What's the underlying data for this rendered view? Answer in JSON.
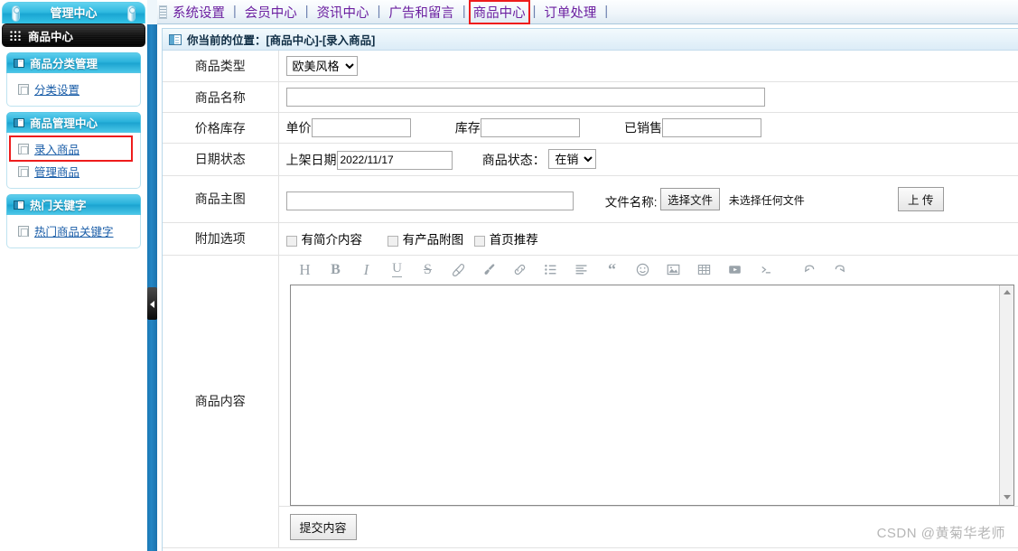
{
  "sidebar": {
    "header_title": "管理中心",
    "current_module": "商品中心",
    "current_module_icon": "grid-dots-icon",
    "groups": [
      {
        "title": "商品分类管理",
        "icon": "window-icon",
        "items": [
          {
            "label": "分类设置",
            "icon": "page-icon",
            "highlighted": false
          }
        ]
      },
      {
        "title": "商品管理中心",
        "icon": "window-icon",
        "items": [
          {
            "label": "录入商品",
            "icon": "page-icon",
            "highlighted": true
          },
          {
            "label": "管理商品",
            "icon": "page-icon",
            "highlighted": false
          }
        ]
      },
      {
        "title": "热门关键字",
        "icon": "window-icon",
        "items": [
          {
            "label": "热门商品关键字",
            "icon": "page-icon",
            "highlighted": false
          }
        ]
      }
    ]
  },
  "topnav": {
    "grip_icon": "drag-grip-icon",
    "separator": "|",
    "items": [
      {
        "label": "系统设置",
        "active": false
      },
      {
        "label": "会员中心",
        "active": false
      },
      {
        "label": "资讯中心",
        "active": false
      },
      {
        "label": "广告和留言",
        "active": false
      },
      {
        "label": "商品中心",
        "active": true
      },
      {
        "label": "订单处理",
        "active": false
      }
    ]
  },
  "breadcrumb": {
    "icon": "info-panel-icon",
    "text": "你当前的位置：[商品中心]-[录入商品]"
  },
  "form": {
    "rows": {
      "type": {
        "label": "商品类型",
        "select_value": "欧美风格",
        "select_options": [
          "欧美风格"
        ]
      },
      "name": {
        "label": "商品名称",
        "value": "",
        "placeholder": ""
      },
      "price_stock": {
        "label": "价格库存",
        "unit_price_label": "单价",
        "unit_price_value": "",
        "stock_label": "库存",
        "stock_value": "",
        "sold_label": "已销售",
        "sold_value": ""
      },
      "date_status": {
        "label": "日期状态",
        "shelf_date_label": "上架日期",
        "shelf_date_value": "2022/11/17",
        "status_label": "商品状态：",
        "status_value": "在销",
        "status_options": [
          "在销"
        ]
      },
      "main_image": {
        "label": "商品主图",
        "path_value": "",
        "file_name_label": "文件名称:",
        "choose_file_button": "选择文件",
        "no_file_text": "未选择任何文件",
        "upload_button": "上 传"
      },
      "extra_options": {
        "label": "附加选项",
        "checkboxes": [
          {
            "label": "有简介内容",
            "checked": false
          },
          {
            "label": "有产品附图",
            "checked": false
          },
          {
            "label": "首页推荐",
            "checked": false
          }
        ]
      },
      "content": {
        "label": "商品内容",
        "editor_value": ""
      }
    },
    "toolbar_icons": [
      "heading-icon",
      "bold-icon",
      "italic-icon",
      "underline-icon",
      "strikethrough-icon",
      "highlight-pen-icon",
      "brush-icon",
      "link-icon",
      "bullet-list-icon",
      "align-left-icon",
      "blockquote-icon",
      "emoji-icon",
      "image-icon",
      "table-icon",
      "video-icon",
      "code-icon",
      "undo-icon",
      "redo-icon"
    ],
    "submit_button": "提交内容"
  },
  "watermark": "CSDN @黄菊华老师",
  "colors": {
    "accent_cyan": "#27b0da",
    "splitter_blue": "#2486c4",
    "nav_text": "#6b1fa0",
    "highlight_red": "#ee1c1c",
    "link_blue": "#1b5ea8"
  }
}
